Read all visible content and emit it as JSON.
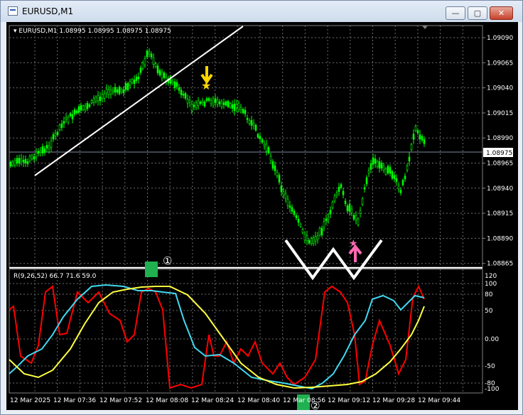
{
  "window": {
    "title": "EURUSD,M1",
    "buttons": {
      "minimize": "—",
      "maximize": "▢",
      "close": "✕"
    }
  },
  "chart": {
    "header": "EURUSD,M1  1.08995 1.08995 1.08975 1.08975",
    "current_price": "1.08975",
    "price_levels": [
      "1.09090",
      "1.09065",
      "1.09040",
      "1.09015",
      "1.08990",
      "1.08965",
      "1.08940",
      "1.08915",
      "1.08890",
      "1.08865"
    ],
    "annotation_1": "①",
    "annotation_2": "②"
  },
  "indicator": {
    "label": "R(9,26,52) 66.7 71.6 59.0",
    "levels": [
      "120",
      "100",
      "80",
      "50",
      "0.00",
      "-50",
      "-80",
      "-100"
    ]
  },
  "time_axis": [
    "12 Mar 2025",
    "12 Mar 07:36",
    "12 Mar 07:52",
    "12 Mar 08:08",
    "12 Mar 08:24",
    "12 Mar 08:40",
    "12 Mar 08:56",
    "12 Mar 09:12",
    "12 Mar 09:28",
    "12 Mar 09:44"
  ],
  "colors": {
    "candles": "#00ff00",
    "red_line": "#ff0000",
    "cyan_line": "#40d8f0",
    "yellow_line": "#ffff40",
    "sell_arrow": "#ffd700",
    "buy_arrow": "#ff69b4",
    "marker_box": "#20b050"
  }
}
